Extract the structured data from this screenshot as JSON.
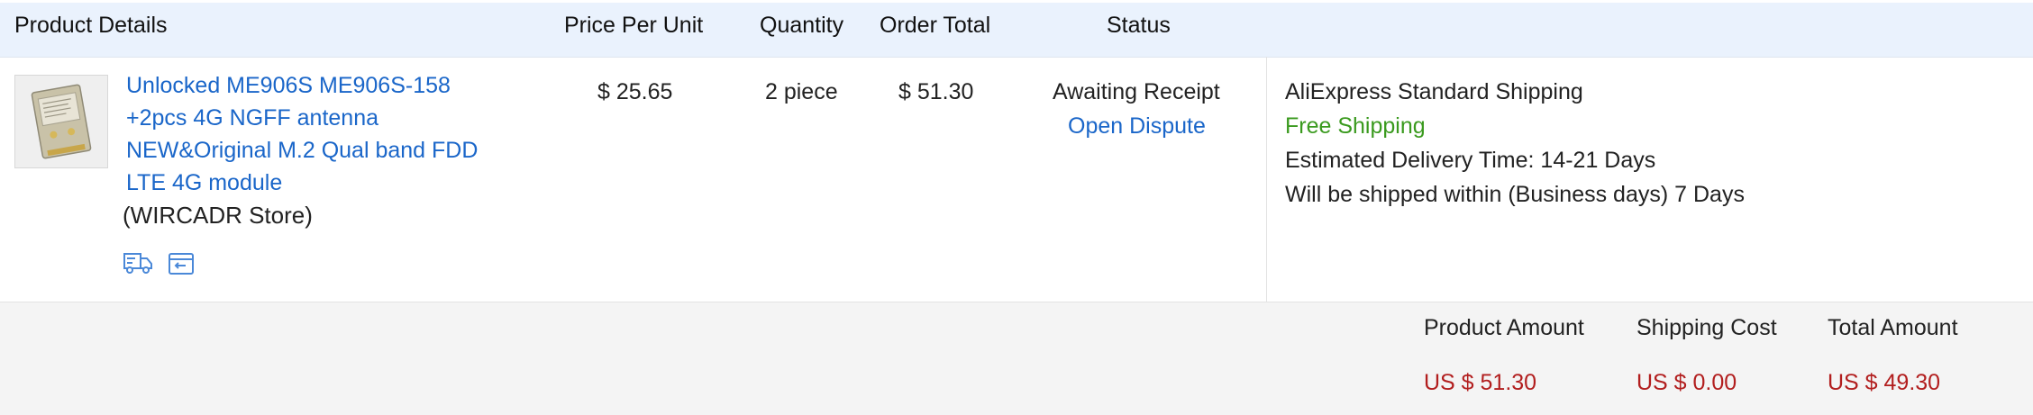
{
  "header": {
    "product_details": "Product Details",
    "price_per_unit": "Price Per Unit",
    "quantity": "Quantity",
    "order_total": "Order Total",
    "status": "Status"
  },
  "item": {
    "name_lines": [
      "Unlocked ME906S ME906S-158",
      "+2pcs 4G NGFF antenna",
      "NEW&Original M.2 Qual band FDD",
      "LTE 4G module"
    ],
    "store": "(WIRCADR Store)",
    "price": "$ 25.65",
    "quantity": "2 piece",
    "order_total": "$ 51.30",
    "status": "Awaiting Receipt",
    "dispute_link": "Open Dispute",
    "icons": [
      "truck-icon",
      "return-box-icon"
    ]
  },
  "shipping": {
    "method": "AliExpress Standard Shipping",
    "cost_note": "Free Shipping",
    "delivery_label": "Estimated Delivery Time:",
    "delivery_value": "14-21 Days",
    "ship_within_label": "Will be shipped within (Business days)",
    "ship_within_value": "7 Days"
  },
  "summary": {
    "product_amount_label": "Product Amount",
    "shipping_cost_label": "Shipping Cost",
    "total_amount_label": "Total Amount",
    "product_amount": "US $ 51.30",
    "shipping_cost": "US $ 0.00",
    "total_amount": "US $ 49.30"
  },
  "colors": {
    "link": "#1a66c9",
    "free_shipping": "#3a9a1e",
    "price_red": "#b21e1e",
    "header_bg": "#eaf2fd",
    "summary_bg": "#f4f4f4"
  }
}
